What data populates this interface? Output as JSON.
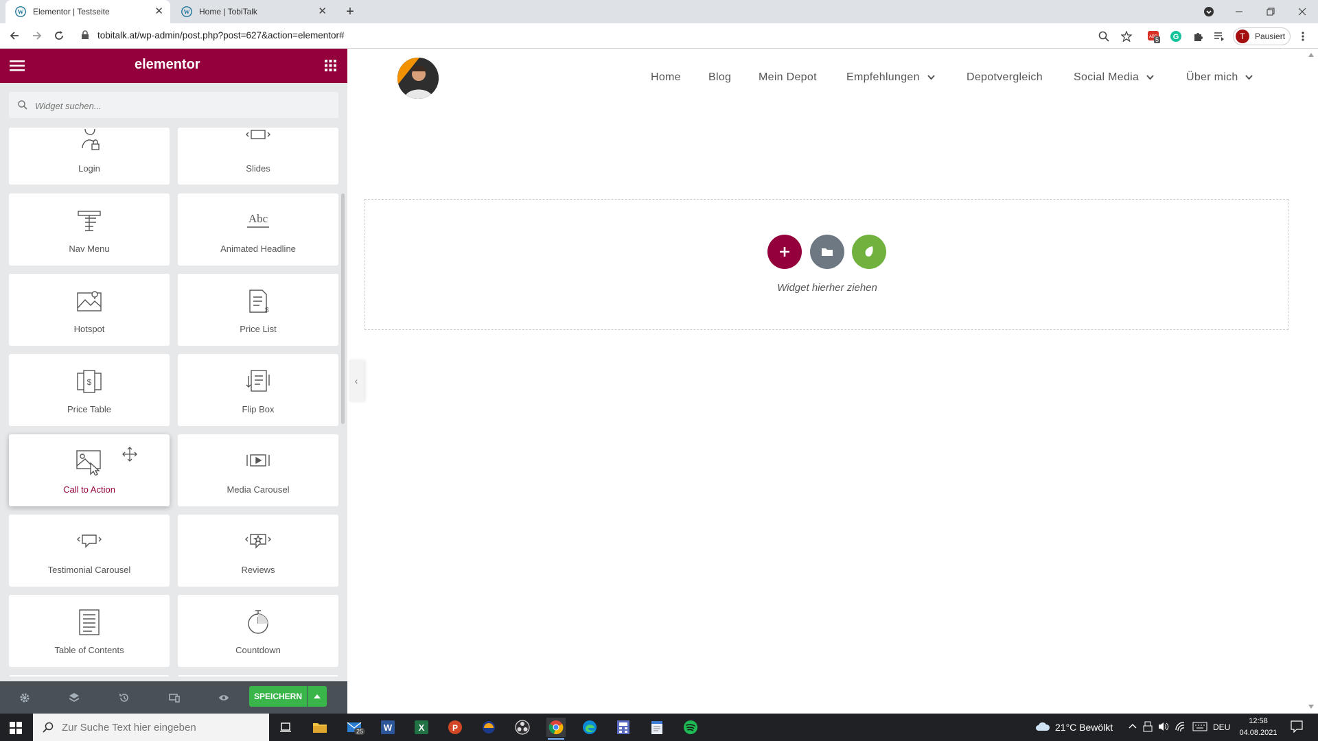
{
  "browser": {
    "tabs": [
      {
        "title": "Elementor | Testseite",
        "active": true
      },
      {
        "title": "Home | TobiTalk",
        "active": false
      }
    ],
    "url": "tobitalk.at/wp-admin/post.php?post=627&action=elementor#",
    "profile_label": "Pausiert",
    "profile_initial": "T",
    "ext_badge": "5"
  },
  "panel": {
    "logo": "elementor",
    "search_placeholder": "Widget suchen...",
    "widgets": [
      {
        "label": "Login",
        "icon": "login-icon"
      },
      {
        "label": "Slides",
        "icon": "slides-icon"
      },
      {
        "label": "Nav Menu",
        "icon": "nav-menu-icon"
      },
      {
        "label": "Animated Headline",
        "icon": "animated-headline-icon"
      },
      {
        "label": "Hotspot",
        "icon": "hotspot-icon"
      },
      {
        "label": "Price List",
        "icon": "price-list-icon"
      },
      {
        "label": "Price Table",
        "icon": "price-table-icon"
      },
      {
        "label": "Flip Box",
        "icon": "flip-box-icon"
      },
      {
        "label": "Call to Action",
        "icon": "call-to-action-icon"
      },
      {
        "label": "Media Carousel",
        "icon": "media-carousel-icon"
      },
      {
        "label": "Testimonial Carousel",
        "icon": "testimonial-carousel-icon"
      },
      {
        "label": "Reviews",
        "icon": "reviews-icon"
      },
      {
        "label": "Table of Contents",
        "icon": "table-of-contents-icon"
      },
      {
        "label": "Countdown",
        "icon": "countdown-icon"
      }
    ],
    "abc_glyph": "Abc",
    "save_label": "SPEICHERN"
  },
  "site_nav": [
    {
      "label": "Home"
    },
    {
      "label": "Blog"
    },
    {
      "label": "Mein Depot"
    },
    {
      "label": "Empfehlungen"
    },
    {
      "label": "Depotvergleich"
    },
    {
      "label": "Social Media"
    },
    {
      "label": "Über mich"
    }
  ],
  "dropzone": {
    "text": "Widget hierher ziehen"
  },
  "taskbar": {
    "search_placeholder": "Zur Suche Text hier eingeben",
    "mail_badge": "25",
    "weather": "21°C  Bewölkt",
    "lang": "DEU",
    "time": "12:58",
    "date": "04.08.2021"
  },
  "colors": {
    "elementor_brand": "#93003c",
    "save_green": "#39b54a",
    "footer_dark": "#495157",
    "folder_gray": "#6d7882",
    "envato_green": "#71b23f"
  }
}
